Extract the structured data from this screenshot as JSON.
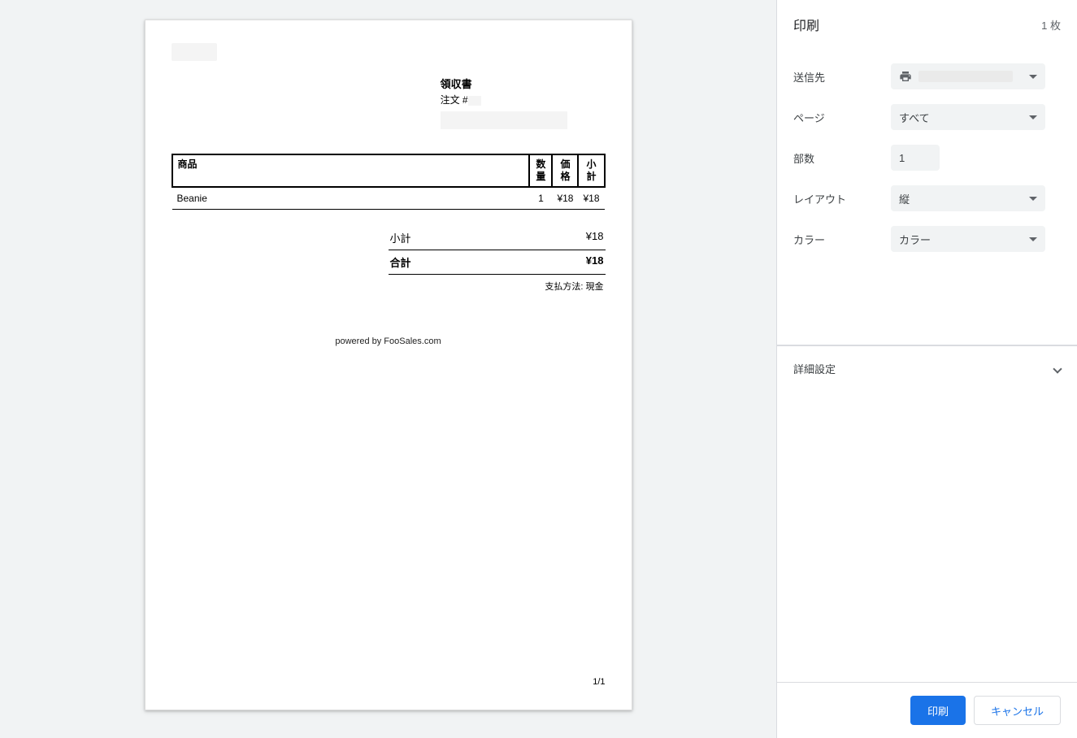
{
  "receipt": {
    "title": "領収書",
    "order_prefix": "注文 #",
    "table": {
      "headers": {
        "product": "商品",
        "qty": "数\n量",
        "price": "価\n格",
        "subtotal": "小\n計"
      },
      "rows": [
        {
          "product": "Beanie",
          "qty": "1",
          "price": "¥18",
          "subtotal": "¥18"
        }
      ]
    },
    "totals": {
      "subtotal_label": "小計",
      "subtotal_value": "¥18",
      "total_label": "合計",
      "total_value": "¥18"
    },
    "payment_method": "支払方法: 現金",
    "powered_by": "powered by FooSales.com",
    "page_number": "1/1"
  },
  "print": {
    "title": "印刷",
    "sheet_count": "1 枚",
    "destination_label": "送信先",
    "destination_value": "",
    "pages_label": "ページ",
    "pages_value": "すべて",
    "copies_label": "部数",
    "copies_value": "1",
    "layout_label": "レイアウト",
    "layout_value": "縦",
    "color_label": "カラー",
    "color_value": "カラー",
    "more_settings": "詳細設定",
    "print_button": "印刷",
    "cancel_button": "キャンセル"
  }
}
